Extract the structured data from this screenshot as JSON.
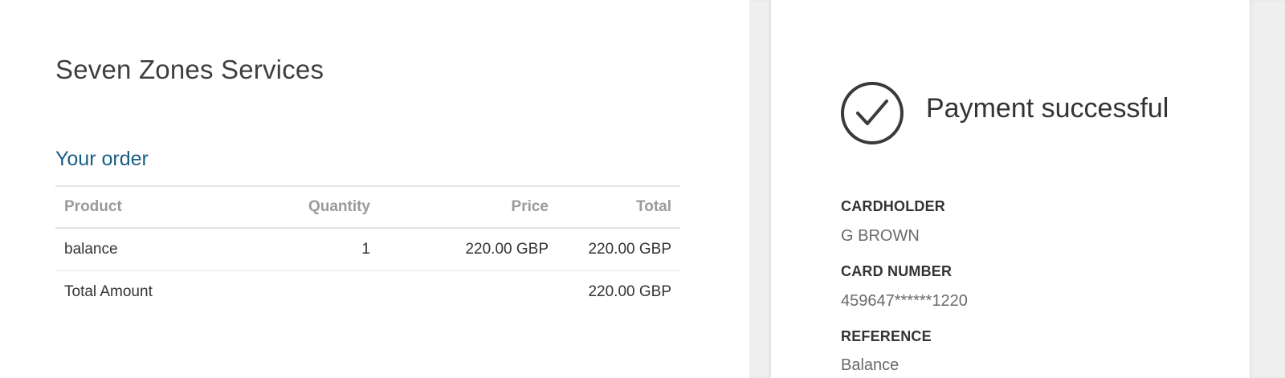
{
  "merchant": {
    "name": "Seven Zones Services"
  },
  "order": {
    "heading": "Your order",
    "columns": [
      "Product",
      "Quantity",
      "Price",
      "Total"
    ],
    "rows": [
      {
        "product": "balance",
        "quantity": "1",
        "price": "220.00 GBP",
        "total": "220.00 GBP"
      }
    ],
    "total_label": "Total Amount",
    "total_value": "220.00 GBP"
  },
  "payment": {
    "status": "Payment successful",
    "status_icon": "check-circle-icon",
    "fields": [
      {
        "label": "CARDHOLDER",
        "value": "G BROWN"
      },
      {
        "label": "CARD NUMBER",
        "value": "459647******1220"
      },
      {
        "label": "REFERENCE",
        "value": "Balance"
      }
    ]
  },
  "colors": {
    "accent": "#1a5e86",
    "text": "#333333",
    "muted": "#9a9a9a",
    "gutter": "#efefef"
  }
}
